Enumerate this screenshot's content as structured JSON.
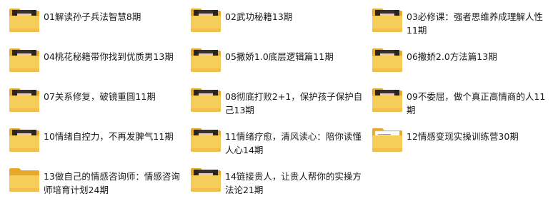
{
  "folders": [
    {
      "name": "01解读孙子兵法智慧8期",
      "thumb": "face"
    },
    {
      "name": "02武功秘籍13期",
      "thumb": "face"
    },
    {
      "name": "03必修课：强者思维养成理解人性11期",
      "thumb": "face"
    },
    {
      "name": "04桃花秘籍带你找到优质男13期",
      "thumb": "face"
    },
    {
      "name": "05撒娇1.0底层逻辑篇11期",
      "thumb": "face"
    },
    {
      "name": "06撒娇2.0方法篇13期",
      "thumb": "face"
    },
    {
      "name": "07关系修复，破镜重圆11期",
      "thumb": "face"
    },
    {
      "name": "08彻底打败2+1，保护孩子保护自己13期",
      "thumb": "face"
    },
    {
      "name": "09不委屈，做个真正高情商的人11期",
      "thumb": "face"
    },
    {
      "name": "10情绪自控力，不再发脾气11期",
      "thumb": "face"
    },
    {
      "name": "11情绪疗愈，清风读心：陪你读懂人心14期",
      "thumb": "face"
    },
    {
      "name": "12情感变现实操训练营30期",
      "thumb": "document"
    },
    {
      "name": "13做自己的情感咨询师：情感咨询师培育计划24期",
      "thumb": "empty"
    },
    {
      "name": "14链接贵人，让贵人帮你的实操方法论21期",
      "thumb": "face"
    }
  ],
  "colors": {
    "folder_back": "#e8a92a",
    "folder_front": "#f7cd5a",
    "folder_front_shade": "#f2c04a",
    "text": "#1a1a1a"
  },
  "icons": {
    "face": "folder-with-portrait-icon",
    "document": "folder-with-document-icon",
    "empty": "folder-icon"
  }
}
